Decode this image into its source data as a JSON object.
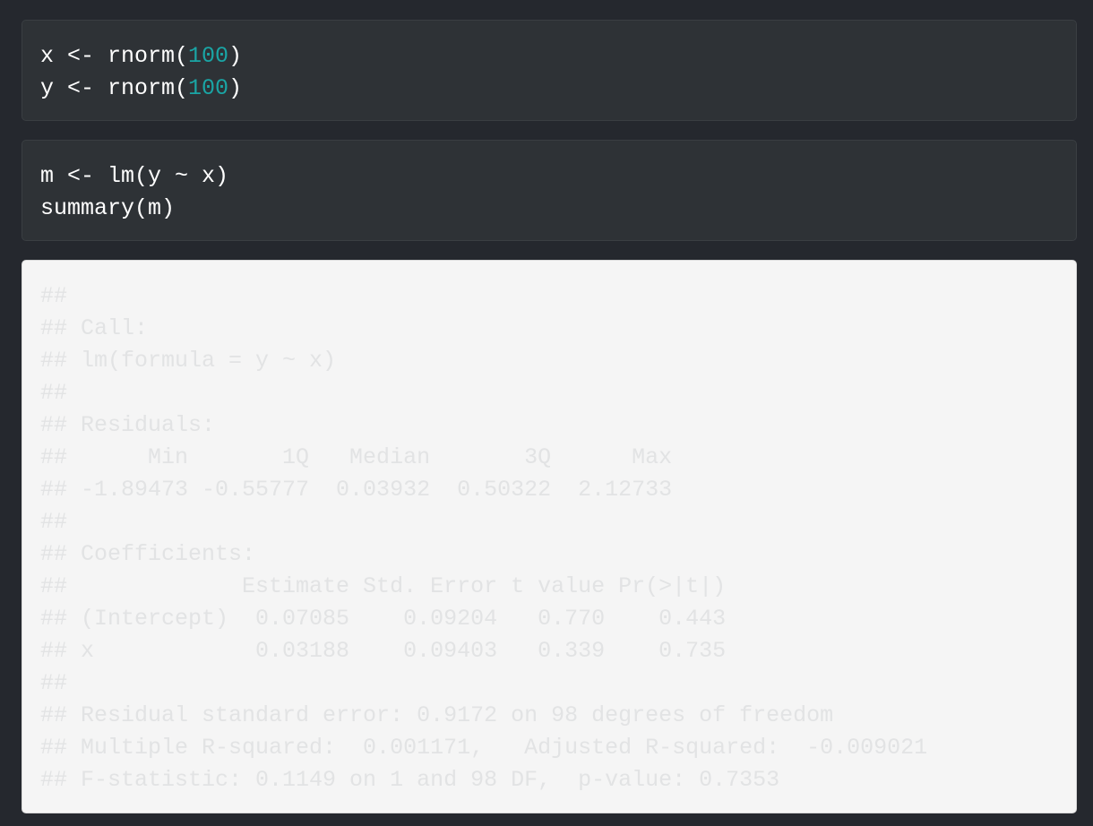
{
  "code_chunk_1": {
    "line_1": {
      "before": "x <- rnorm(",
      "number": "100",
      "after": ")"
    },
    "line_2": {
      "before": "y <- rnorm(",
      "number": "100",
      "after": ")"
    }
  },
  "code_chunk_2": {
    "lines": [
      "m <- lm(y ~ x)",
      "summary(m)"
    ]
  },
  "output": {
    "lines": [
      "##",
      "## Call:",
      "## lm(formula = y ~ x)",
      "##",
      "## Residuals:",
      "##      Min       1Q   Median       3Q      Max",
      "## -1.89473 -0.55777  0.03932  0.50322  2.12733",
      "##",
      "## Coefficients:",
      "##             Estimate Std. Error t value Pr(>|t|)",
      "## (Intercept)  0.07085    0.09204   0.770    0.443",
      "## x            0.03188    0.09403   0.339    0.735",
      "##",
      "## Residual standard error: 0.9172 on 98 degrees of freedom",
      "## Multiple R-squared:  0.001171,   Adjusted R-squared:  -0.009021",
      "## F-statistic: 0.1149 on 1 and 98 DF,  p-value: 0.7353"
    ]
  },
  "colors": {
    "background": "#25282e",
    "code_background": "#2e3236",
    "code_text": "#ffffff",
    "number_literal": "#1aa5a5",
    "output_background": "#f5f5f5",
    "output_text": "#e2e3e4"
  }
}
